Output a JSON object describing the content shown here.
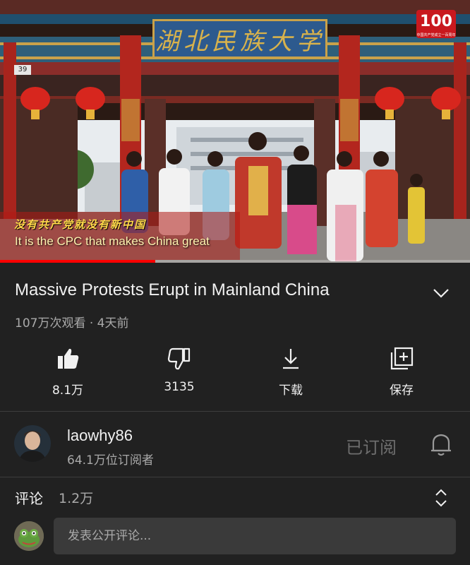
{
  "video": {
    "gate_sign": "湖北民族大学",
    "gate_number": "39",
    "logo_text": "100",
    "logo_caption": "中国共产党成立一百周年",
    "subtitle_cn": "没有共产党就没有新中国",
    "subtitle_en": "It is the CPC that makes China great",
    "progress": 0.33
  },
  "title": "Massive Protests Erupt in Mainland China",
  "meta": {
    "views": "107万次观看",
    "separator": " · ",
    "age": "4天前"
  },
  "actions": [
    {
      "icon": "thumbs-up-icon",
      "label": "8.1万"
    },
    {
      "icon": "thumbs-down-icon",
      "label": "3135"
    },
    {
      "icon": "download-icon",
      "label": "下载"
    },
    {
      "icon": "save-to-playlist-icon",
      "label": "保存"
    }
  ],
  "channel": {
    "name": "laowhy86",
    "subscribers": "64.1万位订阅者",
    "subscribed_label": "已订阅"
  },
  "comments": {
    "label": "评论",
    "count": "1.2万",
    "placeholder": "发表公开评论..."
  },
  "colors": {
    "background": "#212121",
    "progress": "#ff0000",
    "secondary_text": "#aaaaaa"
  }
}
